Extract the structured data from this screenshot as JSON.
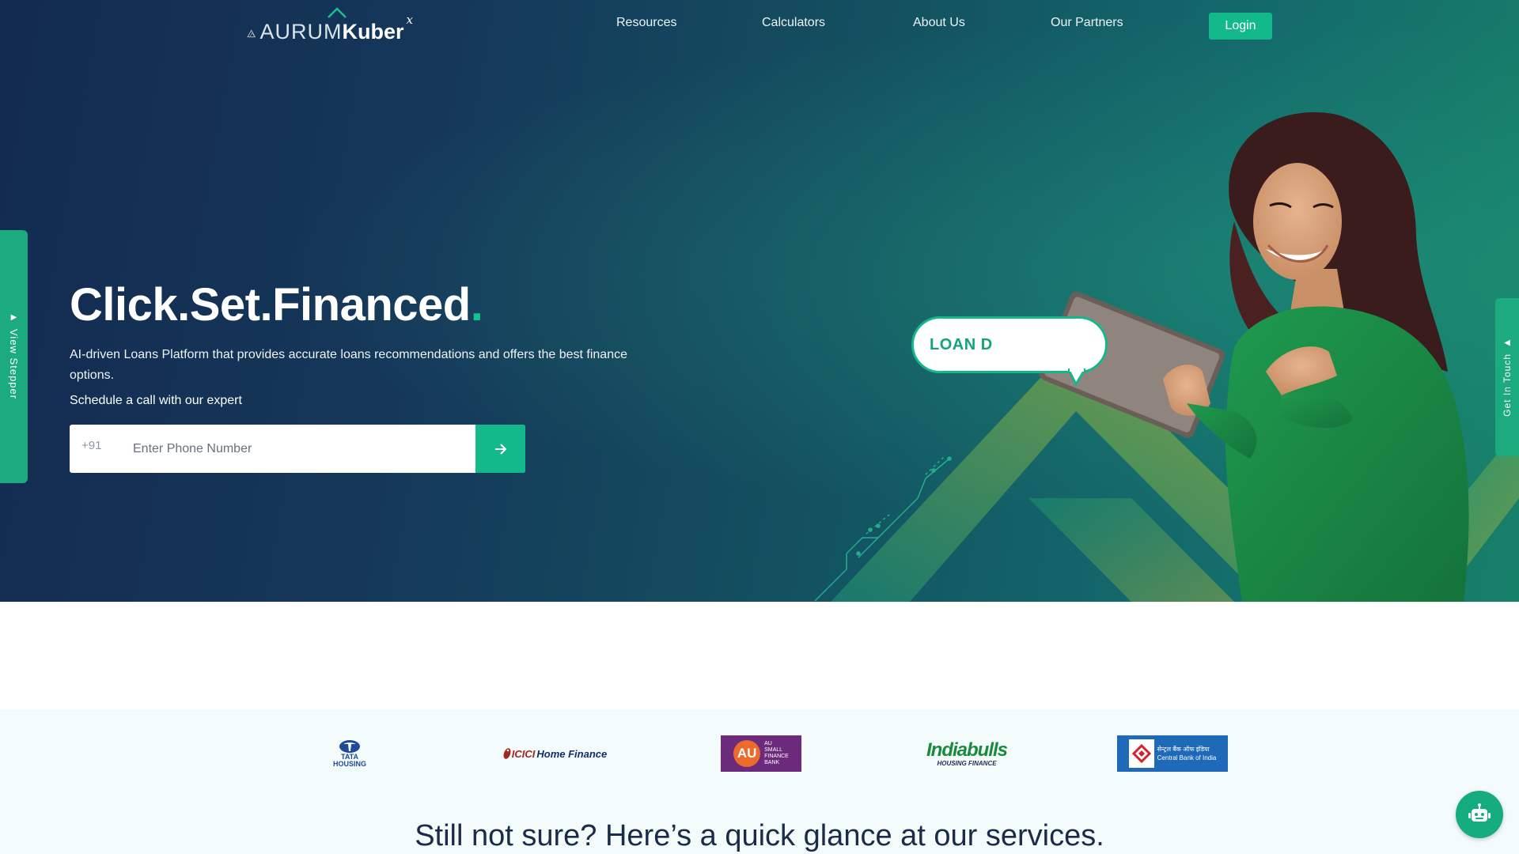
{
  "brand": {
    "logo_aurum": "AURUM",
    "logo_kuber": "Kuber",
    "logo_x": "x"
  },
  "nav": {
    "items": [
      {
        "label": "Resources"
      },
      {
        "label": "Calculators"
      },
      {
        "label": "About Us"
      },
      {
        "label": "Our Partners"
      }
    ],
    "login_label": "Login"
  },
  "side_tabs": {
    "left_label": "View Stepper",
    "right_label": "Get In Touch"
  },
  "hero": {
    "headline": "Click.Set.Financed",
    "headline_dot": ".",
    "subtext": "AI-driven Loans Platform that provides accurate loans recommendations and offers the best finance options.",
    "schedule_label": "Schedule a call with our expert",
    "phone_prefix": "+91",
    "phone_placeholder": "Enter Phone Number",
    "bubble_text": "LOAN D"
  },
  "partners": {
    "tata_line1": "TATA",
    "tata_line2": "HOUSING",
    "icici_brand": "ICICI",
    "icici_rest": "Home Finance",
    "au_mark": "AU",
    "au_line1": "AU",
    "au_line2": "SMALL",
    "au_line3": "FINANCE",
    "au_line4": "BANK",
    "indiabulls_main": "Indiabulls",
    "indiabulls_sub": "HOUSING FINANCE",
    "cbi_hindi": "सेन्ट्रल बैंक ऑफ इंडिया",
    "cbi_english": "Central Bank of India"
  },
  "services": {
    "title": "Still not sure? Here’s a quick glance at our services."
  },
  "colors": {
    "accent": "#13b98a",
    "hero_dark": "#132a50",
    "hero_teal": "#178069",
    "title_dark": "#1b2b4a"
  },
  "icons": {
    "submit": "arrow-right-icon",
    "chatbot": "robot-icon",
    "left_tab": "triangle-right-icon",
    "right_tab": "triangle-left-icon"
  }
}
